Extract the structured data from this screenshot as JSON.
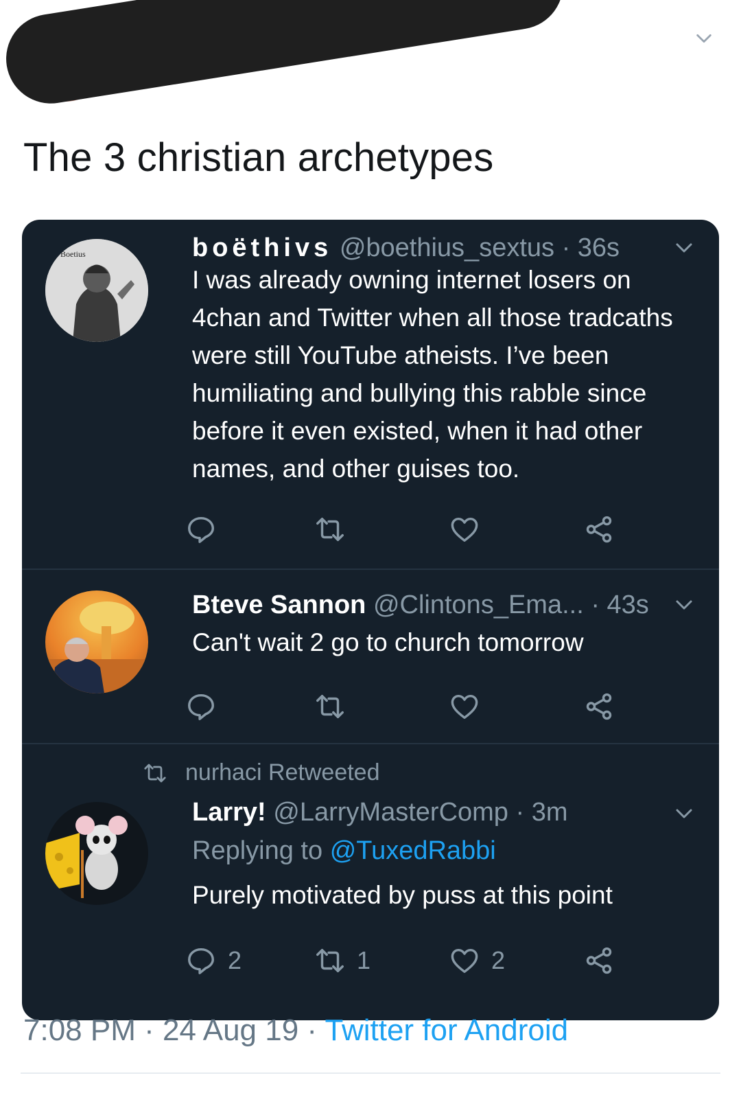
{
  "main_tweet": {
    "text": "The 3 christian archetypes"
  },
  "thread": [
    {
      "name": "boëthivs",
      "handle": "@boethius_sextus",
      "time": "· 36s",
      "text": "I was already owning internet losers on 4chan and Twitter when all those tradcaths were still YouTube atheists. I’ve been humiliating and bullying this rabble since before it even existed, when it had other names, and other guises too.",
      "avatar_label": "Boetius",
      "actions": {
        "reply": "",
        "retweet": "",
        "like": ""
      }
    },
    {
      "name": "Bteve Sannon",
      "handle": "@Clintons_Ema...",
      "time": "· 43s",
      "text": "Can't wait 2 go to church tomorrow",
      "actions": {
        "reply": "",
        "retweet": "",
        "like": ""
      }
    },
    {
      "retweeted_by": "nurhaci Retweeted",
      "name": "Larry!",
      "handle": "@LarryMasterComp",
      "time": "· 3m",
      "replying_to_label": "Replying to",
      "replying_to_handle": "@TuxedRabbi",
      "text": "Purely motivated by puss at this point",
      "actions": {
        "reply": "2",
        "retweet": "1",
        "like": "2"
      }
    }
  ],
  "footer": {
    "time": "7:08 PM",
    "date": "· 24 Aug 19 ·",
    "source": "Twitter for Android"
  },
  "icons": {
    "reply": "reply-icon",
    "retweet": "retweet-icon",
    "like": "heart-icon",
    "share": "share-icon",
    "menu": "chevron-down-icon"
  },
  "colors": {
    "card_bg": "#15202b",
    "muted": "#8899a6",
    "link": "#1da1f2",
    "text_light": "#ffffff",
    "text_dark": "#14171a"
  }
}
